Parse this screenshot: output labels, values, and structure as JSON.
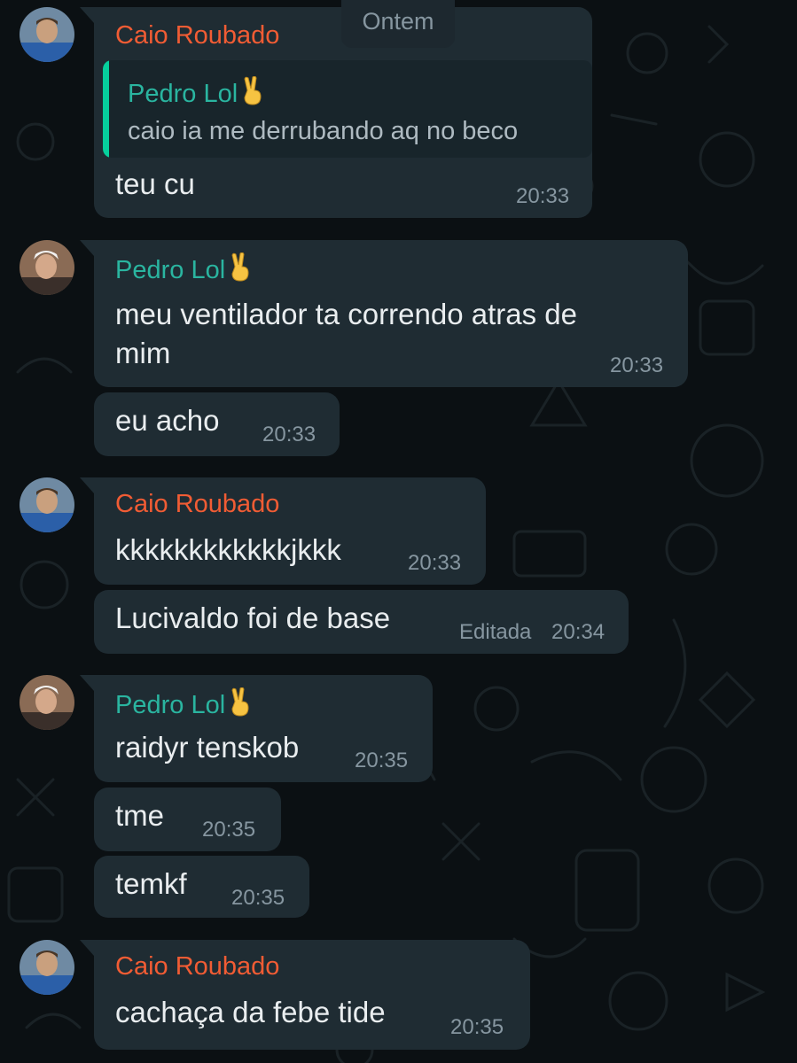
{
  "date_separator": "Ontem",
  "colors": {
    "background": "#0b1013",
    "bubble": "#1f2c33",
    "caio_name": "#f15c34",
    "pedro_name": "#2ab5a0",
    "text": "#e9edef",
    "meta": "#8696a0"
  },
  "messages": [
    {
      "sender": "Caio Roubado",
      "reply": {
        "name": "Pedro Lol",
        "text": "caio  ia me derrubando aq no beco"
      },
      "text": "teu cu",
      "time": "20:33"
    },
    {
      "sender": "Pedro Lol",
      "text_line1": "meu ventilador ta correndo atras de",
      "text_line2": "mim",
      "time": "20:33"
    },
    {
      "text": "eu acho",
      "time": "20:33"
    },
    {
      "sender": "Caio Roubado",
      "text": "kkkkkkkkkkkkjkkk",
      "time": "20:33"
    },
    {
      "text": "Lucivaldo foi de base",
      "edited": "Editada",
      "time": "20:34"
    },
    {
      "sender": "Pedro Lol",
      "text": "raidyr tenskob",
      "time": "20:35"
    },
    {
      "text": "tme",
      "time": "20:35"
    },
    {
      "text": "temkf",
      "time": "20:35"
    },
    {
      "sender": "Caio Roubado",
      "text": "cachaça da febe tide",
      "time": "20:35"
    }
  ],
  "icons": {
    "pedro_name_emoji": "victory-hand-emoji",
    "caio_avatar": "avatar-caio",
    "pedro_avatar": "avatar-pedro"
  }
}
